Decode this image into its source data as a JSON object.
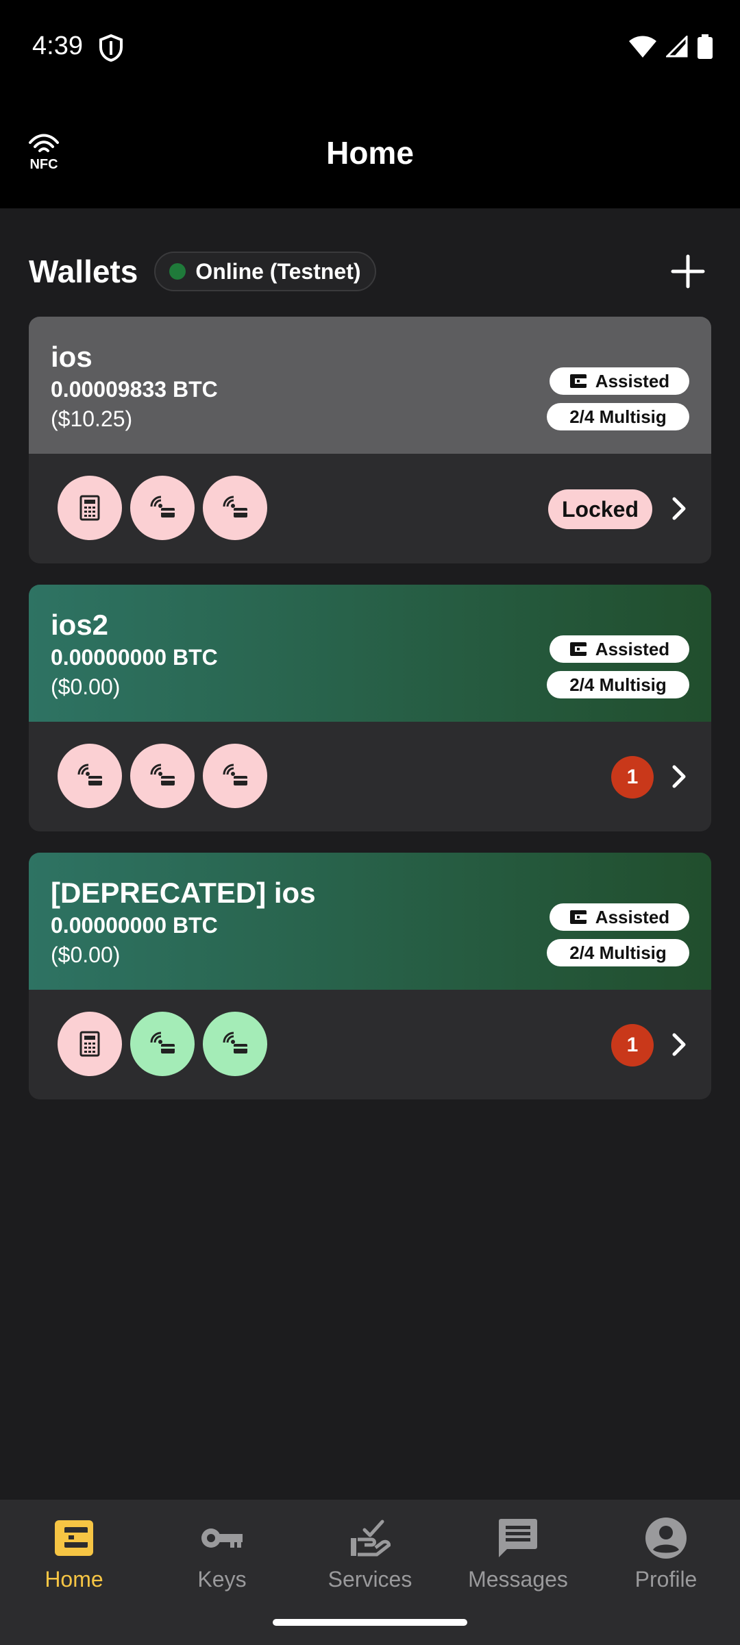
{
  "status_bar": {
    "time": "4:39"
  },
  "header": {
    "title": "Home",
    "nfc_label": "NFC"
  },
  "wallets_section": {
    "title": "Wallets",
    "network_status": "Online (Testnet)"
  },
  "wallets": [
    {
      "name": "ios",
      "balance": "0.00009833 BTC",
      "fiat": "($10.25)",
      "badge_type": "Assisted",
      "badge_scheme": "2/4 Multisig",
      "status": "Locked",
      "keys": [
        "calculator-icon",
        "nfc-card-icon",
        "nfc-card-icon"
      ]
    },
    {
      "name": "ios2",
      "balance": "0.00000000 BTC",
      "fiat": "($0.00)",
      "badge_type": "Assisted",
      "badge_scheme": "2/4 Multisig",
      "pending_count": "1",
      "keys": [
        "nfc-card-icon",
        "nfc-card-icon",
        "nfc-card-icon"
      ]
    },
    {
      "name": "[DEPRECATED] ios",
      "balance": "0.00000000 BTC",
      "fiat": "($0.00)",
      "badge_type": "Assisted",
      "badge_scheme": "2/4 Multisig",
      "pending_count": "1",
      "keys": [
        "calculator-icon",
        "nfc-card-icon",
        "nfc-card-icon"
      ]
    }
  ],
  "nav": {
    "items": [
      {
        "label": "Home",
        "icon": "wallet-icon",
        "active": true
      },
      {
        "label": "Keys",
        "icon": "key-icon"
      },
      {
        "label": "Services",
        "icon": "services-icon"
      },
      {
        "label": "Messages",
        "icon": "message-icon"
      },
      {
        "label": "Profile",
        "icon": "profile-icon"
      }
    ]
  },
  "colors": {
    "accent": "#f6c544",
    "online": "#1f7a3a",
    "pending": "#c9381a",
    "key_pink": "#fbd0d3",
    "key_mint": "#a4ecb7"
  }
}
